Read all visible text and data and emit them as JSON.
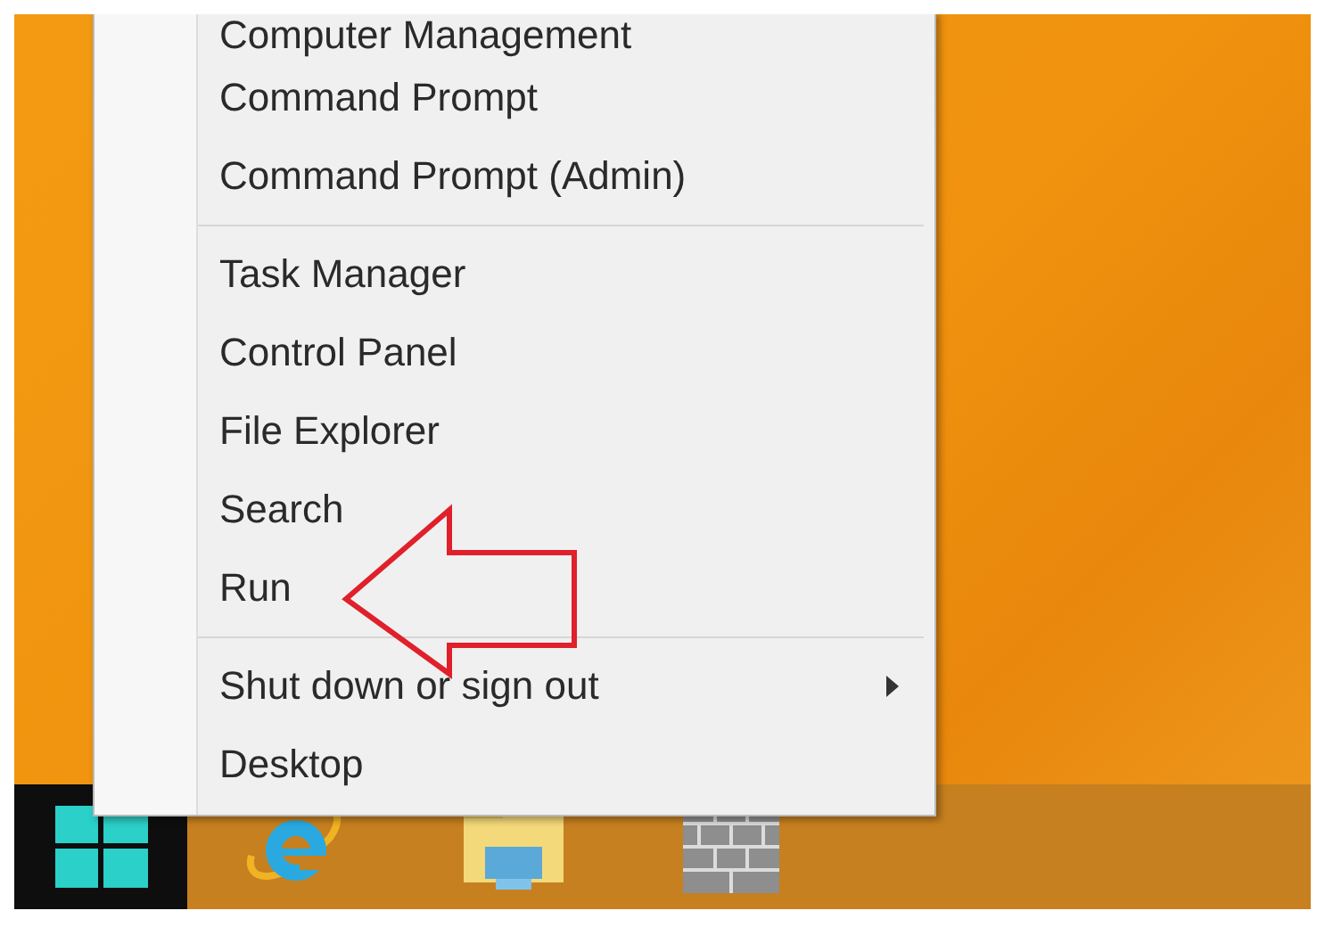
{
  "menu": {
    "groups": [
      [
        {
          "label": "Computer Management",
          "submenu": false
        },
        {
          "label": "Command Prompt",
          "submenu": false
        },
        {
          "label": "Command Prompt (Admin)",
          "submenu": false
        }
      ],
      [
        {
          "label": "Task Manager",
          "submenu": false
        },
        {
          "label": "Control Panel",
          "submenu": false
        },
        {
          "label": "File Explorer",
          "submenu": false
        },
        {
          "label": "Search",
          "submenu": false
        },
        {
          "label": "Run",
          "submenu": false
        }
      ],
      [
        {
          "label": "Shut down or sign out",
          "submenu": true
        },
        {
          "label": "Desktop",
          "submenu": false
        }
      ]
    ]
  }
}
